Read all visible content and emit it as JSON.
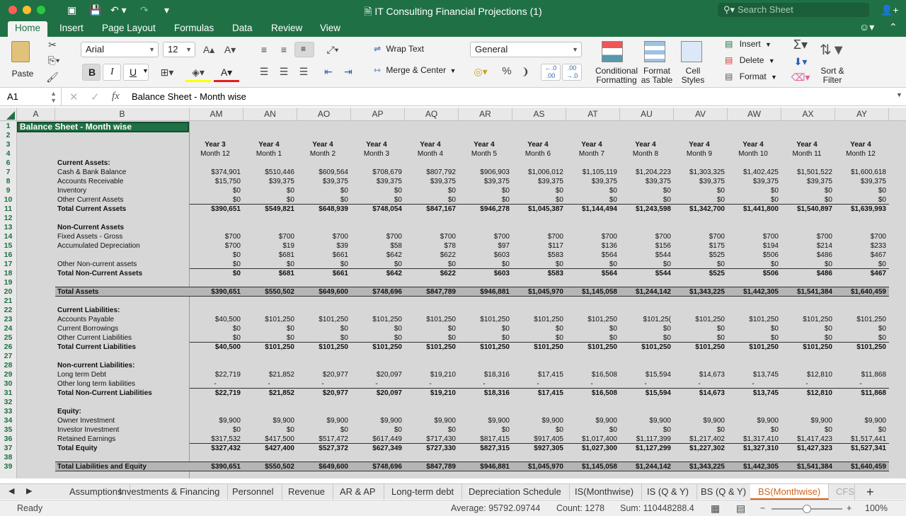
{
  "window": {
    "title": "IT Consulting  Financial Projections (1)",
    "search_placeholder": "Search Sheet"
  },
  "ribbon_tabs": [
    "Home",
    "Insert",
    "Page Layout",
    "Formulas",
    "Data",
    "Review",
    "View"
  ],
  "ribbon": {
    "paste": "Paste",
    "font_name": "Arial",
    "font_size": "12",
    "bold": "B",
    "italic": "I",
    "underline": "U",
    "wrap_text": "Wrap Text",
    "merge_center": "Merge & Center",
    "number_format": "General",
    "percent": "%",
    "conditional_formatting_1": "Conditional",
    "conditional_formatting_2": "Formatting",
    "format_table_1": "Format",
    "format_table_2": "as Table",
    "cell_styles_1": "Cell",
    "cell_styles_2": "Styles",
    "insert": "Insert",
    "delete": "Delete",
    "format": "Format",
    "sort_filter_1": "Sort &",
    "sort_filter_2": "Filter"
  },
  "formula_bar": {
    "name_box": "A1",
    "fx": "fx",
    "content": "Balance Sheet - Month wise"
  },
  "columns": [
    "A",
    "B",
    "AM",
    "AN",
    "AO",
    "AP",
    "AQ",
    "AR",
    "AS",
    "AT",
    "AU",
    "AV",
    "AW",
    "AX",
    "AY"
  ],
  "rows": [
    "1",
    "2",
    "3",
    "4",
    "6",
    "7",
    "8",
    "9",
    "10",
    "11",
    "12",
    "13",
    "14",
    "15",
    "16",
    "17",
    "18",
    "19",
    "20",
    "21",
    "22",
    "23",
    "24",
    "25",
    "26",
    "27",
    "28",
    "29",
    "30",
    "31",
    "32",
    "33",
    "34",
    "35",
    "36",
    "37",
    "38",
    "39"
  ],
  "sheet_title": "Balance Sheet - Month wise",
  "period_year": [
    "Year 3",
    "Year 4",
    "Year 4",
    "Year 4",
    "Year 4",
    "Year 4",
    "Year 4",
    "Year 4",
    "Year 4",
    "Year 4",
    "Year 4",
    "Year 4",
    "Year 4"
  ],
  "period_month": [
    "Month 12",
    "Month 1",
    "Month 2",
    "Month 3",
    "Month 4",
    "Month 5",
    "Month 6",
    "Month 7",
    "Month 8",
    "Month 9",
    "Month 10",
    "Month 11",
    "Month 12"
  ],
  "lines": [
    {
      "row": "6",
      "label": "Current Assets:",
      "bold": true,
      "values": []
    },
    {
      "row": "7",
      "label": "Cash & Bank Balance",
      "values": [
        "$374,901",
        "$510,446",
        "$609,564",
        "$708,679",
        "$807,792",
        "$906,903",
        "$1,006,012",
        "$1,105,119",
        "$1,204,223",
        "$1,303,325",
        "$1,402,425",
        "$1,501,522",
        "$1,600,618"
      ]
    },
    {
      "row": "8",
      "label": "Accounts Receivable",
      "values": [
        "$15,750",
        "$39,375",
        "$39,375",
        "$39,375",
        "$39,375",
        "$39,375",
        "$39,375",
        "$39,375",
        "$39,375",
        "$39,375",
        "$39,375",
        "$39,375",
        "$39,375"
      ]
    },
    {
      "row": "9",
      "label": "Inventory",
      "values": [
        "$0",
        "$0",
        "$0",
        "$0",
        "$0",
        "$0",
        "$0",
        "$0",
        "$0",
        "$0",
        "$0",
        "$0",
        "$0"
      ]
    },
    {
      "row": "10",
      "label": "Other Current Assets",
      "values": [
        "$0",
        "$0",
        "$0",
        "$0",
        "$0",
        "$0",
        "$0",
        "$0",
        "$0",
        "$0",
        "$0",
        "$0",
        "$0"
      ]
    },
    {
      "row": "11",
      "label": "Total Current Assets",
      "bold": true,
      "values": [
        "$390,651",
        "$549,821",
        "$648,939",
        "$748,054",
        "$847,167",
        "$946,278",
        "$1,045,387",
        "$1,144,494",
        "$1,243,598",
        "$1,342,700",
        "$1,441,800",
        "$1,540,897",
        "$1,639,993"
      ]
    },
    {
      "row": "13",
      "label": "Non-Current Assets",
      "bold": true,
      "values": []
    },
    {
      "row": "14",
      "label": "Fixed Assets - Gross",
      "values": [
        "$700",
        "$700",
        "$700",
        "$700",
        "$700",
        "$700",
        "$700",
        "$700",
        "$700",
        "$700",
        "$700",
        "$700",
        "$700"
      ]
    },
    {
      "row": "15",
      "label": "Accumulated Depreciation",
      "values": [
        "$700",
        "$19",
        "$39",
        "$58",
        "$78",
        "$97",
        "$117",
        "$136",
        "$156",
        "$175",
        "$194",
        "$214",
        "$233"
      ]
    },
    {
      "row": "16",
      "label": "",
      "values": [
        "$0",
        "$681",
        "$661",
        "$642",
        "$622",
        "$603",
        "$583",
        "$564",
        "$544",
        "$525",
        "$506",
        "$486",
        "$467"
      ]
    },
    {
      "row": "17",
      "label": "Other Non-current assets",
      "values": [
        "$0",
        "$0",
        "$0",
        "$0",
        "$0",
        "$0",
        "$0",
        "$0",
        "$0",
        "$0",
        "$0",
        "$0",
        "$0"
      ]
    },
    {
      "row": "18",
      "label": "Total Non-Current Assets",
      "bold": true,
      "values": [
        "$0",
        "$681",
        "$661",
        "$642",
        "$622",
        "$603",
        "$583",
        "$564",
        "$544",
        "$525",
        "$506",
        "$486",
        "$467"
      ]
    },
    {
      "row": "20",
      "label": "Total Assets",
      "bold": true,
      "values": [
        "$390,651",
        "$550,502",
        "$649,600",
        "$748,696",
        "$847,789",
        "$946,881",
        "$1,045,970",
        "$1,145,058",
        "$1,244,142",
        "$1,343,225",
        "$1,442,305",
        "$1,541,384",
        "$1,640,459"
      ]
    },
    {
      "row": "22",
      "label": "Current Liabilities:",
      "bold": true,
      "values": []
    },
    {
      "row": "23",
      "label": "Accounts Payable",
      "values": [
        "$40,500",
        "$101,250",
        "$101,250",
        "$101,250",
        "$101,250",
        "$101,250",
        "$101,250",
        "$101,250",
        "$101,25(",
        "$101,250",
        "$101,250",
        "$101,250",
        "$101,250"
      ]
    },
    {
      "row": "24",
      "label": "Current Borrowings",
      "values": [
        "$0",
        "$0",
        "$0",
        "$0",
        "$0",
        "$0",
        "$0",
        "$0",
        "$0",
        "$0",
        "$0",
        "$0",
        "$0"
      ]
    },
    {
      "row": "25",
      "label": "Other Current Liabilities",
      "values": [
        "$0",
        "$0",
        "$0",
        "$0",
        "$0",
        "$0",
        "$0",
        "$0",
        "$0",
        "$0",
        "$0",
        "$0",
        "$0"
      ]
    },
    {
      "row": "26",
      "label": "Total Current Liabilities",
      "bold": true,
      "values": [
        "$40,500",
        "$101,250",
        "$101,250",
        "$101,250",
        "$101,250",
        "$101,250",
        "$101,250",
        "$101,250",
        "$101,250",
        "$101,250",
        "$101,250",
        "$101,250",
        "$101,250"
      ]
    },
    {
      "row": "28",
      "label": "Non-current Liabilities:",
      "bold": true,
      "values": []
    },
    {
      "row": "29",
      "label": "Long term Debt",
      "values": [
        "$22,719",
        "$21,852",
        "$20,977",
        "$20,097",
        "$19,210",
        "$18,316",
        "$17,415",
        "$16,508",
        "$15,594",
        "$14,673",
        "$13,745",
        "$12,810",
        "$11,868"
      ]
    },
    {
      "row": "30",
      "label": "Other long term liabilities",
      "values": [
        "-",
        "-",
        "-",
        "-",
        "-",
        "-",
        "-",
        "-",
        "-",
        "-",
        "-",
        "-",
        "-"
      ]
    },
    {
      "row": "31",
      "label": "Total Non-Current Liabilities",
      "bold": true,
      "values": [
        "$22,719",
        "$21,852",
        "$20,977",
        "$20,097",
        "$19,210",
        "$18,316",
        "$17,415",
        "$16,508",
        "$15,594",
        "$14,673",
        "$13,745",
        "$12,810",
        "$11,868"
      ]
    },
    {
      "row": "33",
      "label": "Equity:",
      "bold": true,
      "values": []
    },
    {
      "row": "34",
      "label": "Owner Investment",
      "values": [
        "$9,900",
        "$9,900",
        "$9,900",
        "$9,900",
        "$9,900",
        "$9,900",
        "$9,900",
        "$9,900",
        "$9,900",
        "$9,900",
        "$9,900",
        "$9,900",
        "$9,900"
      ]
    },
    {
      "row": "35",
      "label": "Investor Investment",
      "values": [
        "$0",
        "$0",
        "$0",
        "$0",
        "$0",
        "$0",
        "$0",
        "$0",
        "$0",
        "$0",
        "$0",
        "$0",
        "$0"
      ]
    },
    {
      "row": "36",
      "label": "Retained Earnings",
      "values": [
        "$317,532",
        "$417,500",
        "$517,472",
        "$617,449",
        "$717,430",
        "$817,415",
        "$917,405",
        "$1,017,400",
        "$1,117,399",
        "$1,217,402",
        "$1,317,410",
        "$1,417,423",
        "$1,517,441"
      ]
    },
    {
      "row": "37",
      "label": "Total Equity",
      "bold": true,
      "values": [
        "$327,432",
        "$427,400",
        "$527,372",
        "$627,349",
        "$727,330",
        "$827,315",
        "$927,305",
        "$1,027,300",
        "$1,127,299",
        "$1,227,302",
        "$1,327,310",
        "$1,427,323",
        "$1,527,341"
      ]
    },
    {
      "row": "39",
      "label": "Total Liabilities and Equity",
      "bold": true,
      "values": [
        "$390,651",
        "$550,502",
        "$649,600",
        "$748,696",
        "$847,789",
        "$946,881",
        "$1,045,970",
        "$1,145,058",
        "$1,244,142",
        "$1,343,225",
        "$1,442,305",
        "$1,541,384",
        "$1,640,459"
      ]
    }
  ],
  "sheet_tabs": [
    "Assumptions",
    "Investments & Financing",
    "Personnel",
    "Revenue",
    "AR & AP",
    "Long-term debt",
    "Depreciation Schedule",
    "IS(Monthwise)",
    "IS (Q & Y)",
    "BS (Q & Y)",
    "BS(Monthwise)",
    "CFS"
  ],
  "active_sheet": "BS(Monthwise)",
  "status": {
    "ready": "Ready",
    "average": "Average: 95792.09744",
    "count": "Count: 1278",
    "sum": "Sum: 110448288.4",
    "zoom": "100%"
  },
  "colors": {
    "excel_green": "#1f7145",
    "active_tab": "#d0641b",
    "header_fill": "#1f7145"
  }
}
